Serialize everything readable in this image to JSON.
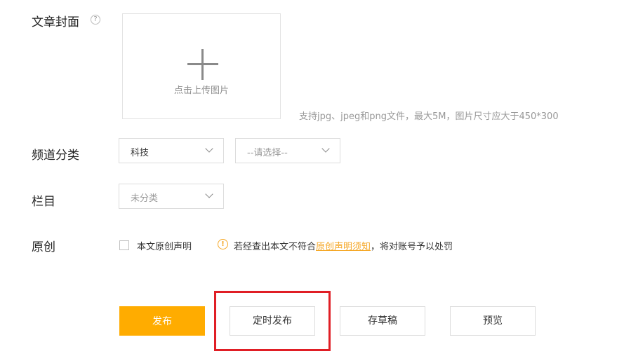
{
  "cover": {
    "label": "文章封面",
    "help_icon": "question-circle-icon",
    "upload_text": "点击上传图片",
    "upload_icon": "plus-icon",
    "hint": "支持jpg、jpeg和png文件，最大5M，图片尺寸应大于450*300"
  },
  "channel": {
    "label": "频道分类",
    "primary_value": "科技",
    "secondary_placeholder": "--请选择--"
  },
  "column": {
    "label": "栏目",
    "value": "未分类"
  },
  "original": {
    "label": "原创",
    "checkbox_label": "本文原创声明",
    "checked": false,
    "warning_prefix": "若经查出本文不符合",
    "warning_link": "原创声明须知",
    "warning_suffix": "，将对账号予以处罚",
    "warning_icon": "exclamation-circle-icon"
  },
  "actions": {
    "publish": "发布",
    "schedule": "定时发布",
    "draft": "存草稿",
    "preview": "预览"
  },
  "colors": {
    "primary": "#ffac00",
    "warning": "#f5a623",
    "highlight": "#e01e25"
  }
}
